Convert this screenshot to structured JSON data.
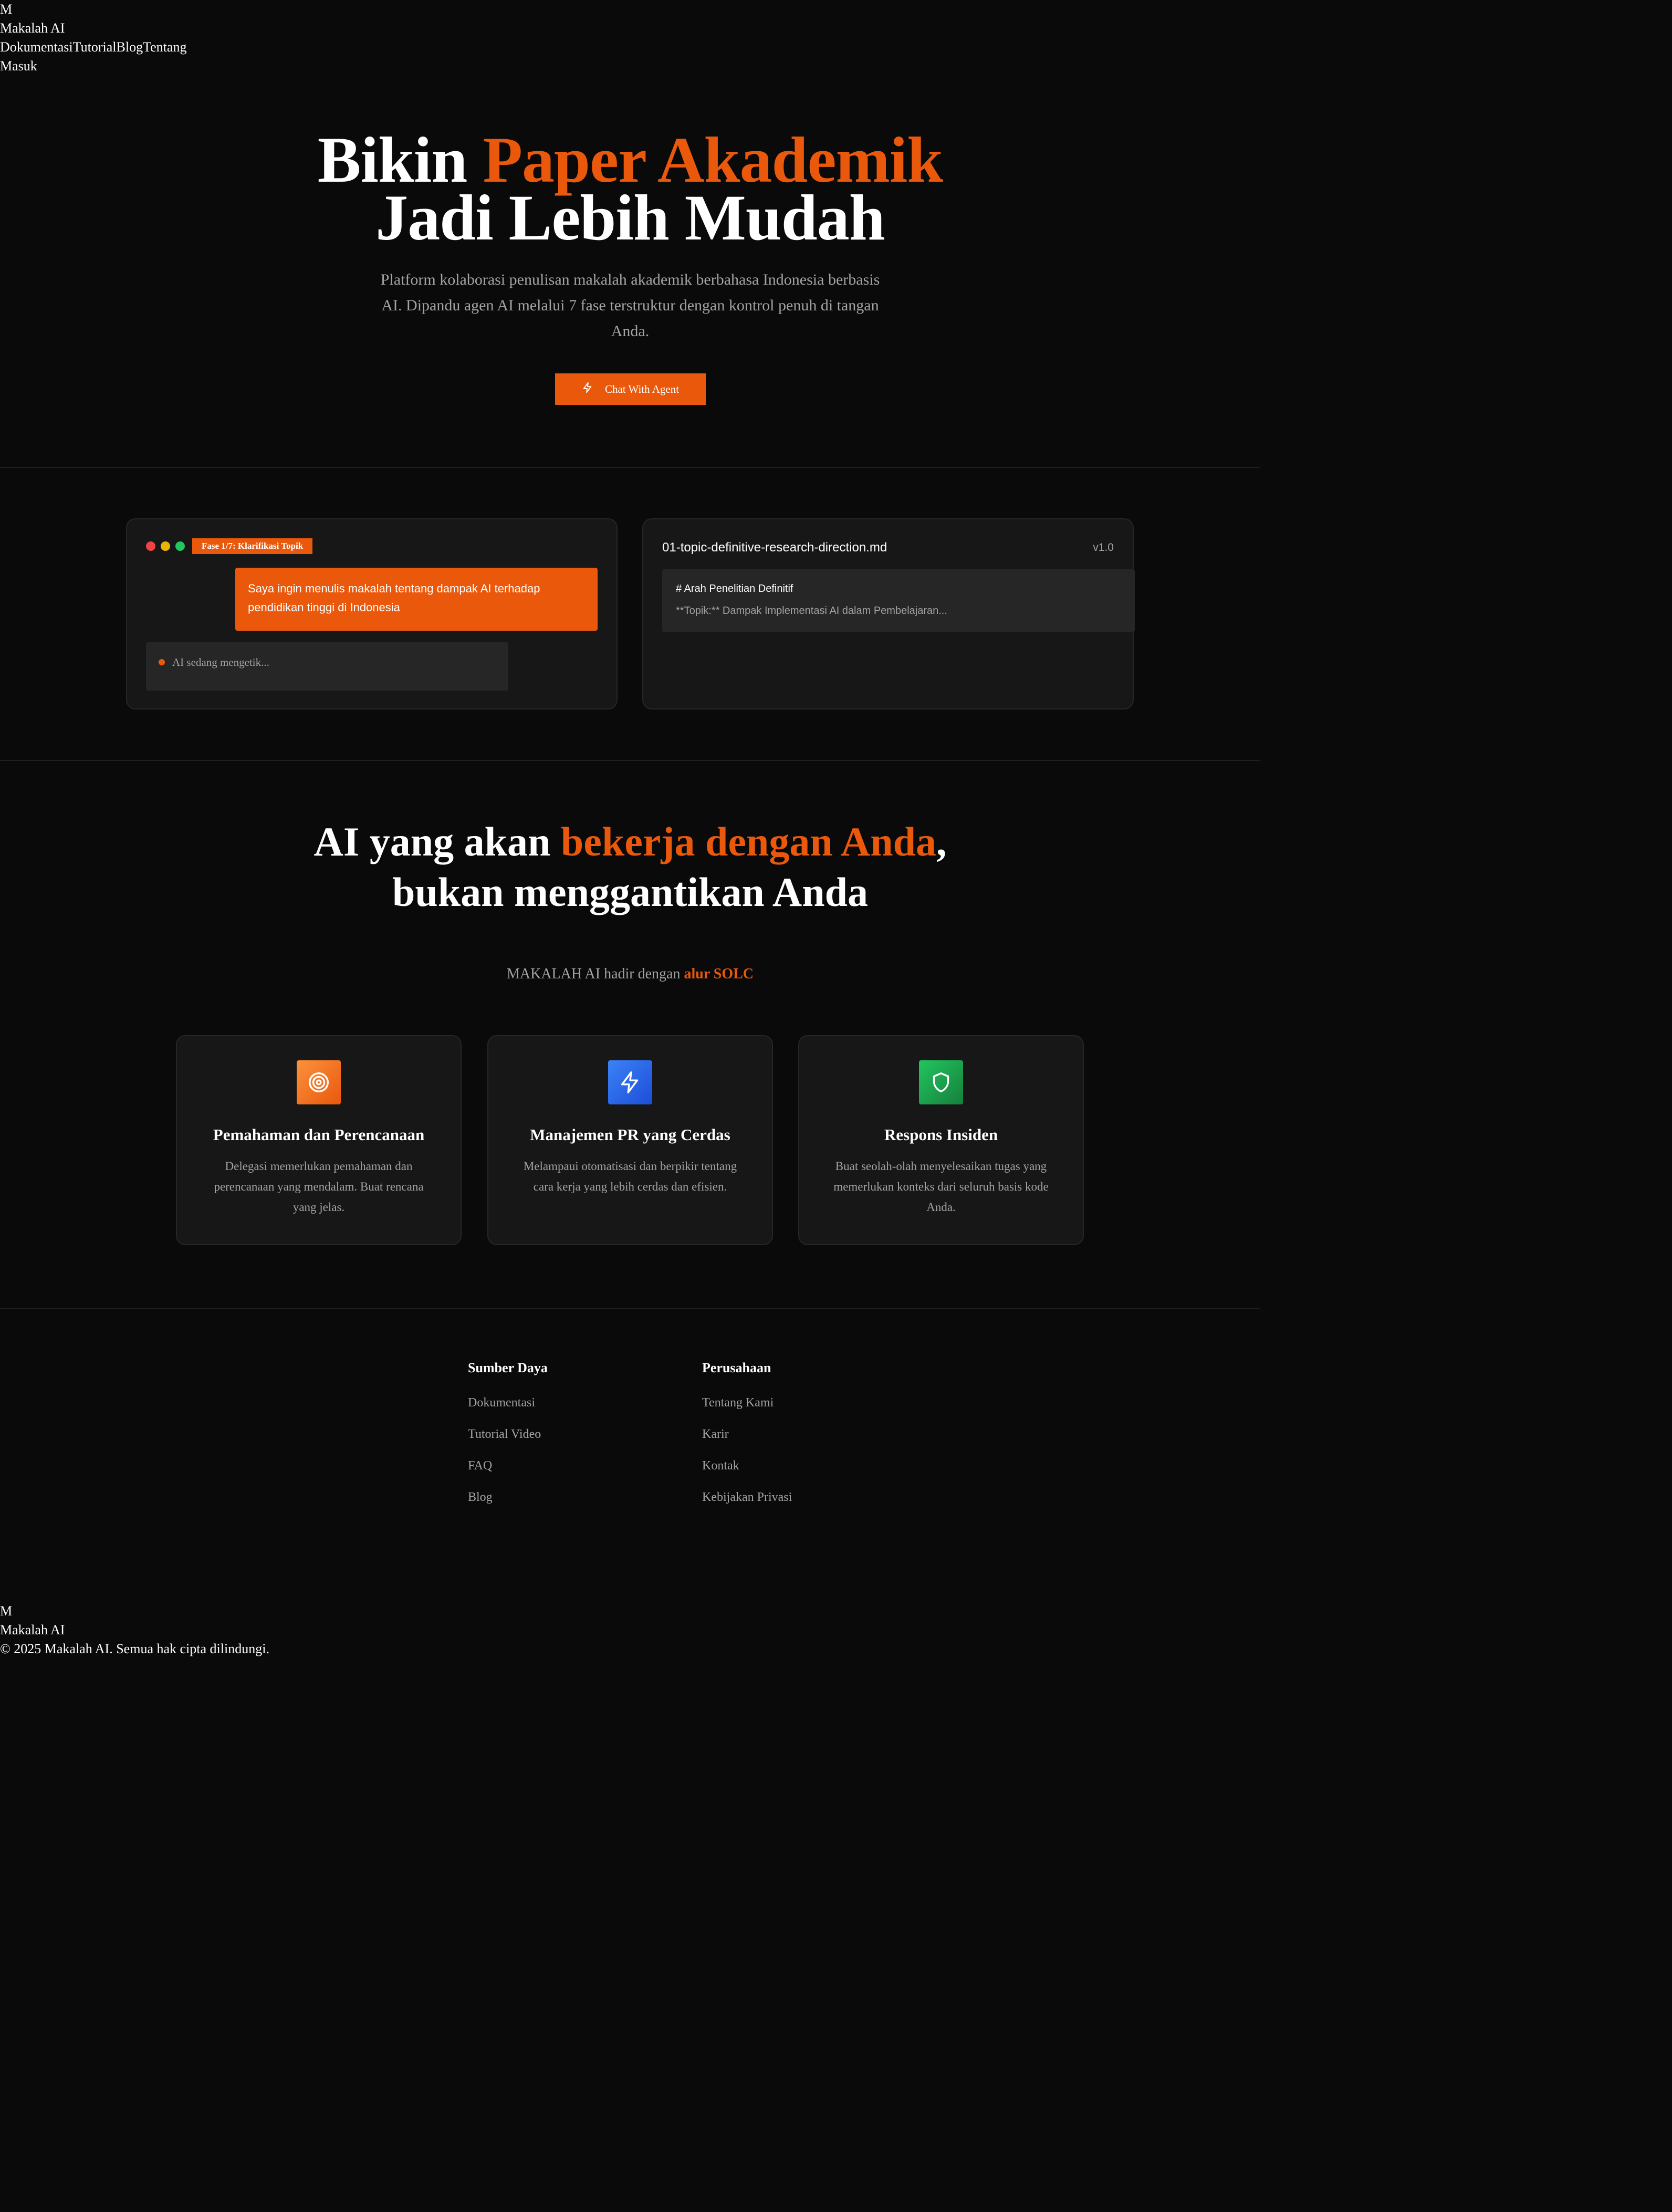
{
  "header": {
    "logo_letter": "M",
    "brand": "Makalah AI",
    "nav": [
      "Dokumentasi",
      "Tutorial",
      "Blog",
      "Tentang"
    ],
    "login": "Masuk"
  },
  "hero": {
    "title_part1": "Bikin ",
    "title_accent": "Paper Akademik",
    "title_line2": "Jadi Lebih Mudah",
    "subtitle": "Platform kolaborasi penulisan makalah akademik berbahasa Indonesia berbasis AI. Dipandu agen AI melalui 7 fase terstruktur dengan kontrol penuh di tangan Anda.",
    "cta_label": "Chat With Agent"
  },
  "demo": {
    "chat": {
      "phase_badge": "Fase 1/7: Klarifikasi Topik",
      "user_message": "Saya ingin menulis makalah tentang dampak AI terhadap pendidikan tinggi di Indonesia",
      "typing_text": "AI sedang mengetik..."
    },
    "doc": {
      "filename": "01-topic-definitive-research-direction.md",
      "version": "v1.0",
      "heading": "# Arah Penelitian Definitif",
      "line": "**Topik:** Dampak Implementasi AI dalam Pembelajaran..."
    }
  },
  "features_section": {
    "heading_part1": "AI yang akan ",
    "heading_accent": "bekerja dengan Anda",
    "heading_part2": ",",
    "heading_line2": "bukan menggantikan Anda",
    "tagline_prefix": "MAKALAH AI hadir dengan ",
    "tagline_strong": "alur SOLC",
    "cards": [
      {
        "icon": "target-icon",
        "icon_color": "#f97316",
        "title": "Pemahaman dan Perencanaan",
        "desc": "Delegasi memerlukan pemahaman dan perencanaan yang mendalam. Buat rencana yang jelas."
      },
      {
        "icon": "lightning-icon",
        "icon_color": "#2563eb",
        "title": "Manajemen PR yang Cerdas",
        "desc": "Melampaui otomatisasi dan berpikir tentang cara kerja yang lebih cerdas dan efisien."
      },
      {
        "icon": "shield-icon",
        "icon_color": "#16a34a",
        "title": "Respons Insiden",
        "desc": "Buat seolah-olah menyelesaikan tugas yang memerlukan konteks dari seluruh basis kode Anda."
      }
    ]
  },
  "footer": {
    "resources": {
      "title": "Sumber Daya",
      "items": [
        "Dokumentasi",
        "Tutorial Video",
        "FAQ",
        "Blog"
      ]
    },
    "company": {
      "title": "Perusahaan",
      "items": [
        "Tentang Kami",
        "Karir",
        "Kontak",
        "Kebijakan Privasi"
      ]
    },
    "logo_letter": "M",
    "brand": "Makalah AI",
    "copyright": "© 2025 Makalah AI. Semua hak cipta dilindungi."
  },
  "colors": {
    "accent": "#ea580c",
    "background": "#0a0a0a",
    "card": "#171717",
    "muted_text": "#a3a3a3"
  }
}
